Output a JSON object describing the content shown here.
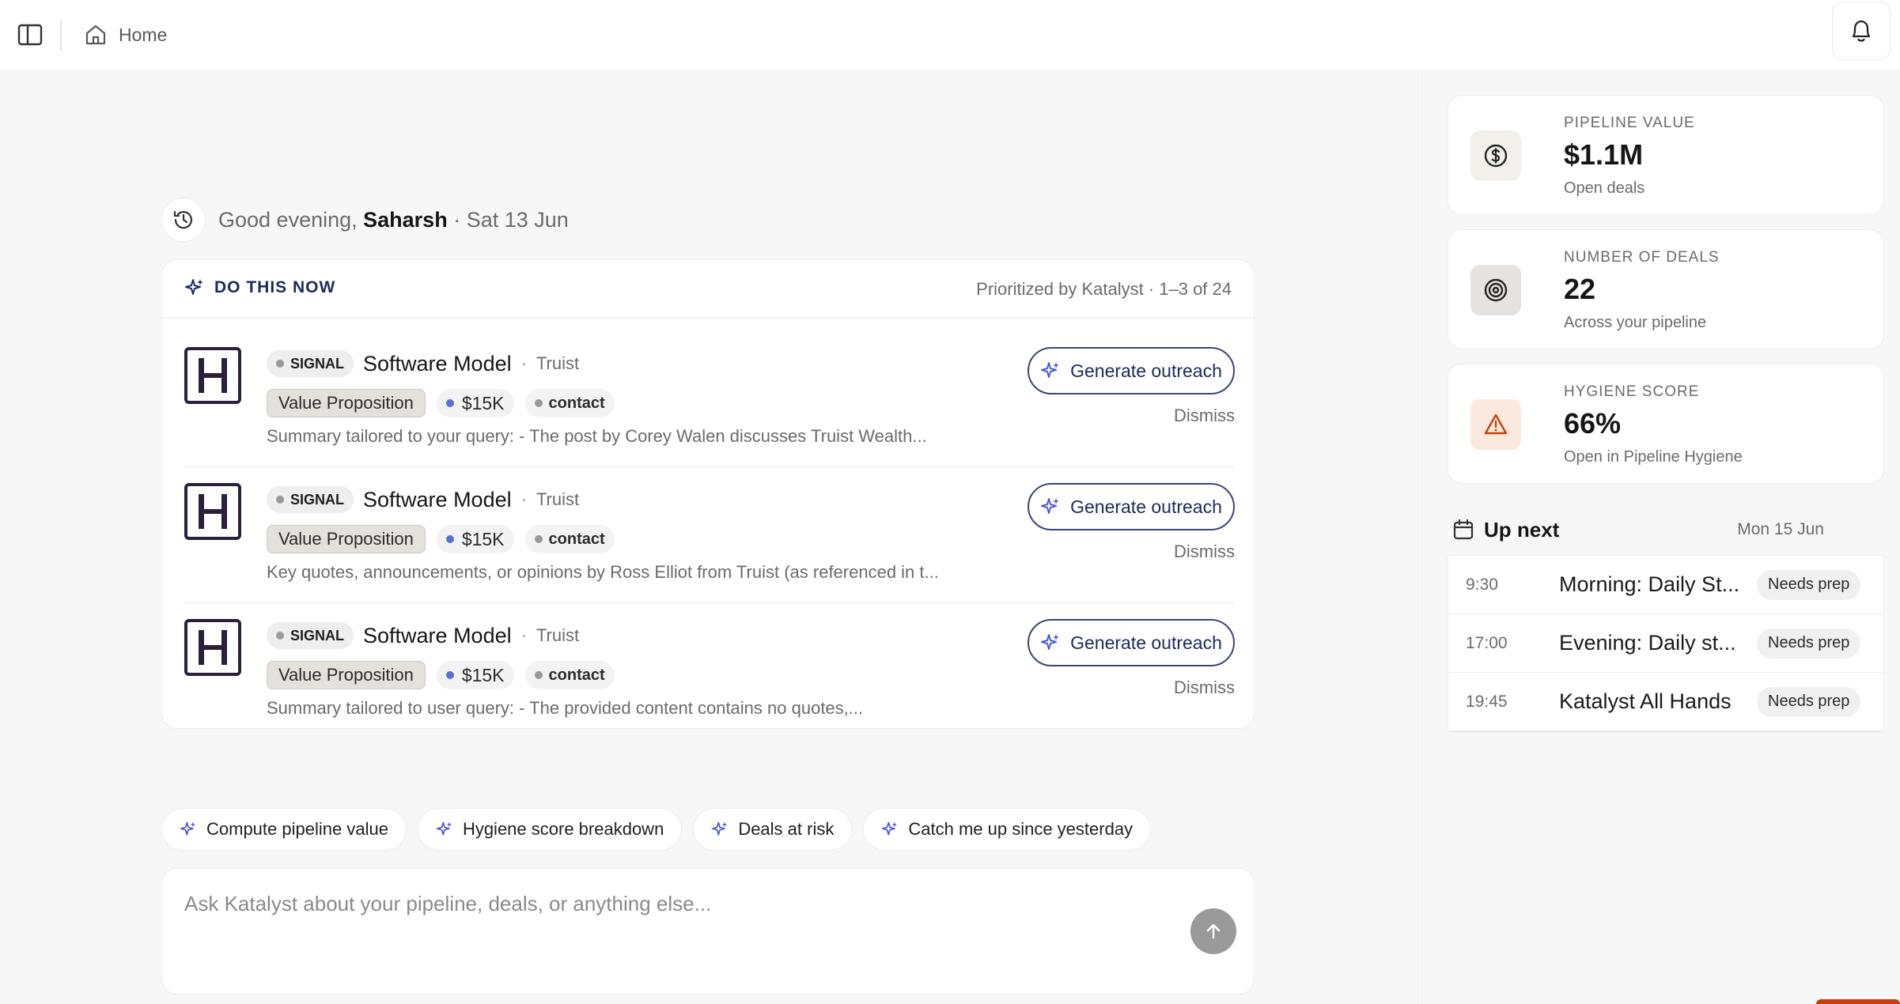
{
  "header": {
    "breadcrumb": "Home"
  },
  "greeting": {
    "prefix": "Good evening, ",
    "name": "Saharsh",
    "date": " · Sat 13 Jun"
  },
  "do_now": {
    "title": "DO THIS NOW",
    "meta": "Prioritized by Katalyst · 1–3 of 24",
    "items": [
      {
        "badge": "SIGNAL",
        "title": "Software Model",
        "company": "Truist",
        "tag": "Value Proposition",
        "amount": "$15K",
        "contact": "contact",
        "summary": "Summary tailored to your query: - The post by Corey Walen discusses Truist Wealth...",
        "action": "Generate outreach",
        "dismiss": "Dismiss"
      },
      {
        "badge": "SIGNAL",
        "title": "Software Model",
        "company": "Truist",
        "tag": "Value Proposition",
        "amount": "$15K",
        "contact": "contact",
        "summary": "Key quotes, announcements, or opinions by Ross Elliot from Truist (as referenced in t...",
        "action": "Generate outreach",
        "dismiss": "Dismiss"
      },
      {
        "badge": "SIGNAL",
        "title": "Software Model",
        "company": "Truist",
        "tag": "Value Proposition",
        "amount": "$15K",
        "contact": "contact",
        "summary": "Summary tailored to user query: - The provided content contains no quotes,...",
        "action": "Generate outreach",
        "dismiss": "Dismiss"
      }
    ]
  },
  "chips": [
    "Compute pipeline value",
    "Hygiene score breakdown",
    "Deals at risk",
    "Catch me up since yesterday"
  ],
  "ask": {
    "placeholder": "Ask Katalyst about your pipeline, deals, or anything else..."
  },
  "stats": [
    {
      "label": "PIPELINE VALUE",
      "value": "$1.1M",
      "sub": "Open deals",
      "icon": "dollar-icon"
    },
    {
      "label": "NUMBER OF DEALS",
      "value": "22",
      "sub": "Across your pipeline",
      "icon": "target-icon"
    },
    {
      "label": "HYGIENE SCORE",
      "value": "66%",
      "sub": "Open in Pipeline Hygiene",
      "icon": "warning-icon"
    }
  ],
  "up_next": {
    "title": "Up next",
    "date": "Mon 15 Jun",
    "events": [
      {
        "time": "9:30",
        "title": "Morning: Daily St...",
        "badge": "Needs prep"
      },
      {
        "time": "17:00",
        "title": "Evening: Daily st...",
        "badge": "Needs prep"
      },
      {
        "time": "19:45",
        "title": "Katalyst All Hands",
        "badge": "Needs prep"
      }
    ]
  },
  "colors": {
    "accent_navy": "#1e2a5a",
    "sparkle": "#4a5bd6",
    "hygiene_warning": "#c2410c",
    "background": "#f7f7f8"
  }
}
